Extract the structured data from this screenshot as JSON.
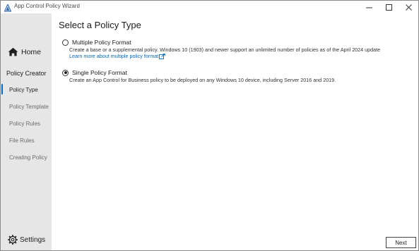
{
  "window": {
    "title": "App Control Policy Wizard",
    "accent_color": "#0067c0",
    "icons": {
      "minimize": "minimize-icon",
      "maximize": "maximize-icon",
      "close": "close-icon",
      "app": "wizard-app-icon"
    }
  },
  "sidebar": {
    "home_label": "Home",
    "section_label": "Policy Creator",
    "items": [
      {
        "label": "Policy Type",
        "active": true
      },
      {
        "label": "Policy Template",
        "active": false
      },
      {
        "label": "Policy Rules",
        "active": false
      },
      {
        "label": "File Rules",
        "active": false
      },
      {
        "label": "Creating Policy",
        "active": false
      }
    ],
    "settings_label": "Settings"
  },
  "main": {
    "title": "Select a Policy Type",
    "options": [
      {
        "label": "Multiple Policy Format",
        "checked": false,
        "description": "Create a base or a supplemental policy. Windows 10 (1903) and newer support an unlimited number of policies as of the April 2024 update",
        "link_text": "Learn more about multiple policy format"
      },
      {
        "label": "Single Policy Format",
        "checked": true,
        "description": "Create an App Control for Business policy to be deployed on any Windows 10 device, including Server 2016 and 2019."
      }
    ],
    "next_label": "Next"
  }
}
